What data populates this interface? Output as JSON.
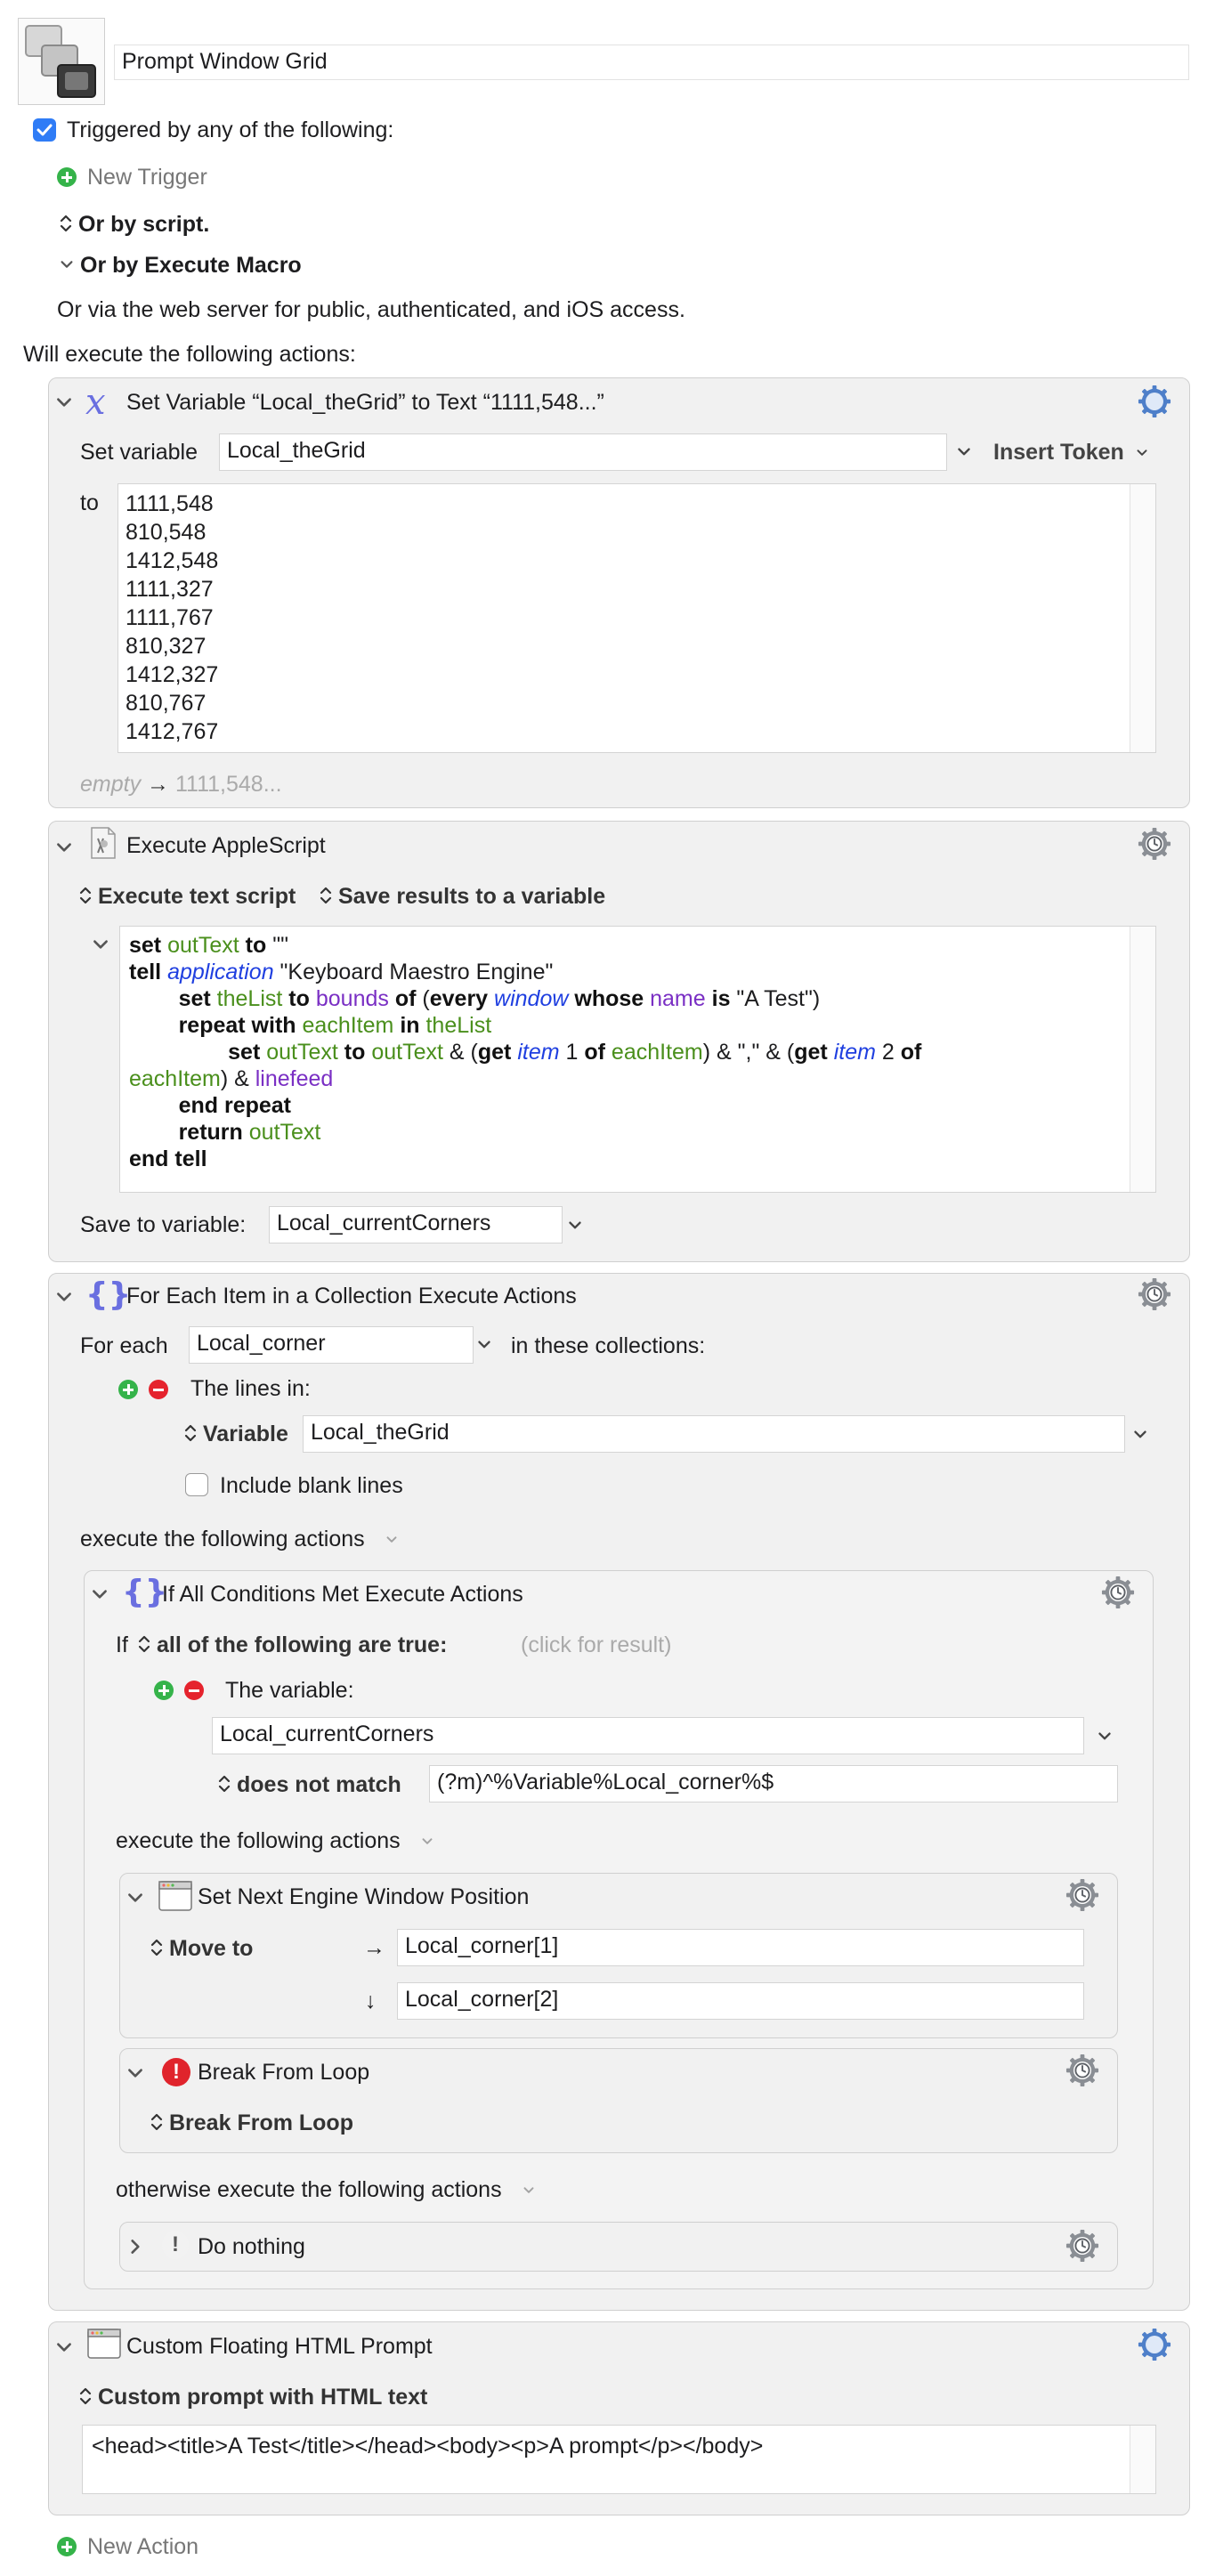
{
  "macro": {
    "name": "Prompt Window Grid",
    "triggered_label": "Triggered by any of the following:",
    "triggered_checked": true,
    "new_trigger": "New Trigger",
    "or_by_script": "Or by script.",
    "or_by_execute_macro": "Or by Execute Macro",
    "web_server_note": "Or via the web server for public, authenticated, and iOS access.",
    "will_execute": "Will execute the following actions:",
    "new_action": "New Action"
  },
  "actions": {
    "set_variable": {
      "title": "Set Variable “Local_theGrid” to Text “1111,548...”",
      "set_variable_label": "Set variable",
      "variable": "Local_theGrid",
      "insert_token": "Insert Token",
      "to_label": "to",
      "lines": [
        "1111,548",
        "810,548",
        "1412,548",
        "1111,327",
        "1111,767",
        "810,327",
        "1412,327",
        "810,767",
        "1412,767"
      ],
      "preview_empty": "empty",
      "preview_value": "1111,548..."
    },
    "applescript": {
      "title": "Execute AppleScript",
      "mode": "Execute text script",
      "save_results": "Save results to a variable",
      "save_to_label": "Save to variable:",
      "save_to_value": "Local_currentCorners"
    },
    "for_each": {
      "title": "For Each Item in a Collection Execute Actions",
      "for_each_label": "For each",
      "variable": "Local_corner",
      "in_collections": "in these collections:",
      "lines_in": "The lines in:",
      "variable_label": "Variable",
      "variable_value": "Local_theGrid",
      "include_blank": "Include blank lines",
      "execute_following": "execute the following actions"
    },
    "if_all": {
      "title": "If All Conditions Met Execute Actions",
      "if_label": "If",
      "all_following": "all of the following are true:",
      "click_for_result": "(click for result)",
      "the_variable": "The variable:",
      "variable_value": "Local_currentCorners",
      "does_not_match": "does not match",
      "match_value": "(?m)^%Variable%Local_corner%$",
      "execute_following": "execute the following actions",
      "otherwise": "otherwise execute the following actions"
    },
    "set_window": {
      "title": "Set Next Engine Window Position",
      "move_to": "Move to",
      "x_value": "Local_corner[1]",
      "y_value": "Local_corner[2]"
    },
    "break_loop": {
      "title": "Break From Loop",
      "mode": "Break From Loop"
    },
    "do_nothing": {
      "title": "Do nothing"
    },
    "html_prompt": {
      "title": "Custom Floating HTML Prompt",
      "mode": "Custom prompt with HTML text",
      "html_text": "<head><title>A Test</title></head><body><p>A prompt</p></body>"
    }
  }
}
